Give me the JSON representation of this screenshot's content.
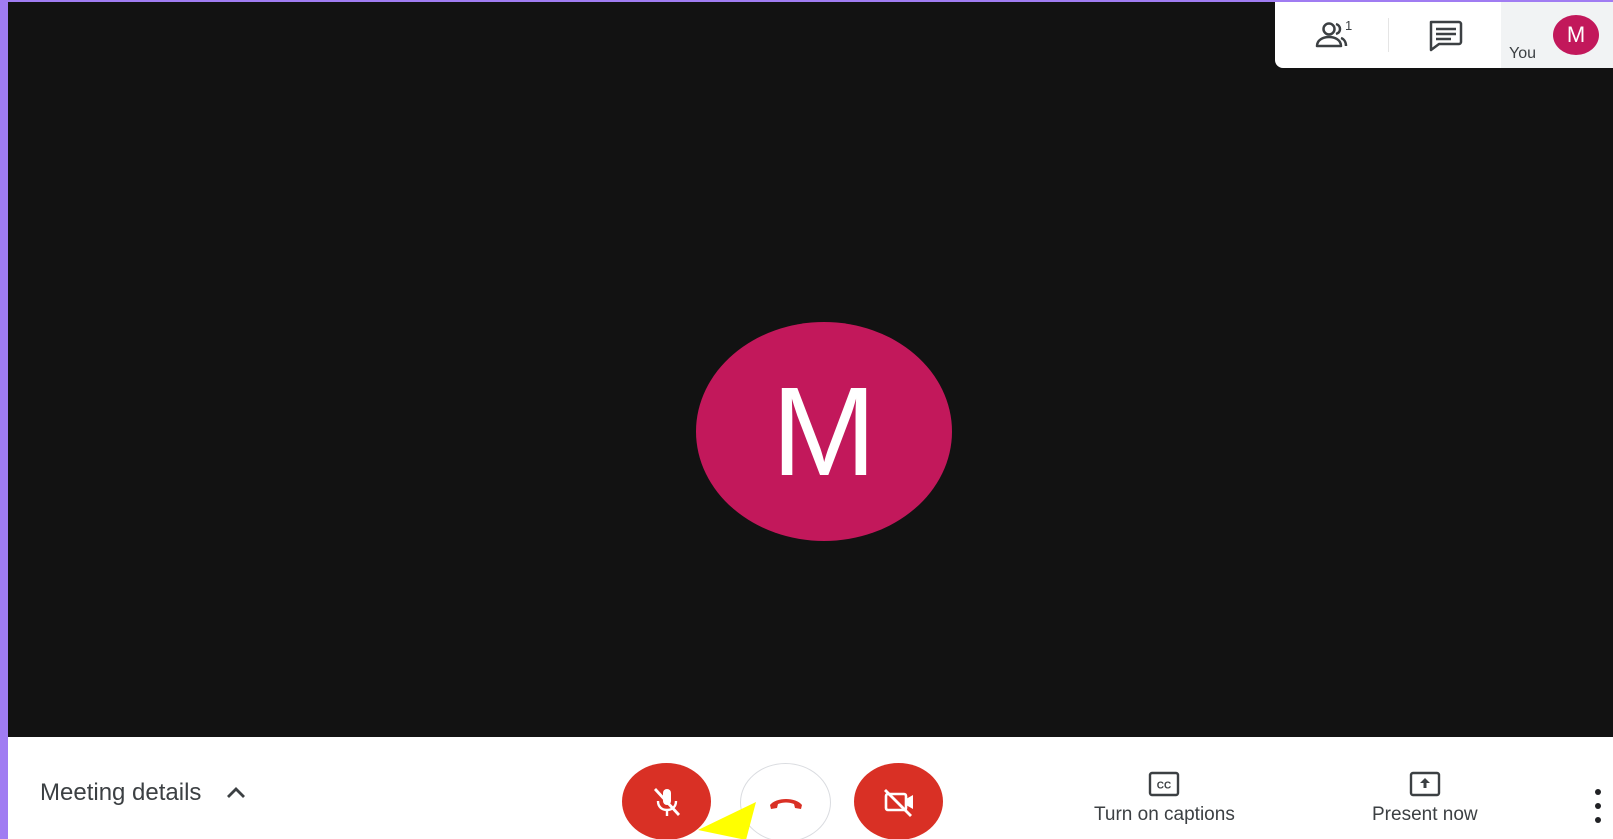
{
  "meeting": {
    "participant_initial": "M",
    "avatar_color": "#c2185b",
    "people_count": "1",
    "self_label": "You",
    "self_initial": "M"
  },
  "top_panel": {
    "people_icon": "people-icon",
    "chat_icon": "chat-icon"
  },
  "bottom_bar": {
    "meeting_details_label": "Meeting details",
    "mic_icon": "mic-off-icon",
    "hangup_icon": "phone-hangup-icon",
    "camera_icon": "camera-off-icon",
    "captions_label": "Turn on captions",
    "present_label": "Present now",
    "more_icon": "more-vert-icon"
  },
  "colors": {
    "accent_red": "#d93025",
    "avatar": "#c2185b",
    "background_dark": "#121212",
    "page_border": "#a07cf2",
    "pointer": "#ffff00"
  }
}
